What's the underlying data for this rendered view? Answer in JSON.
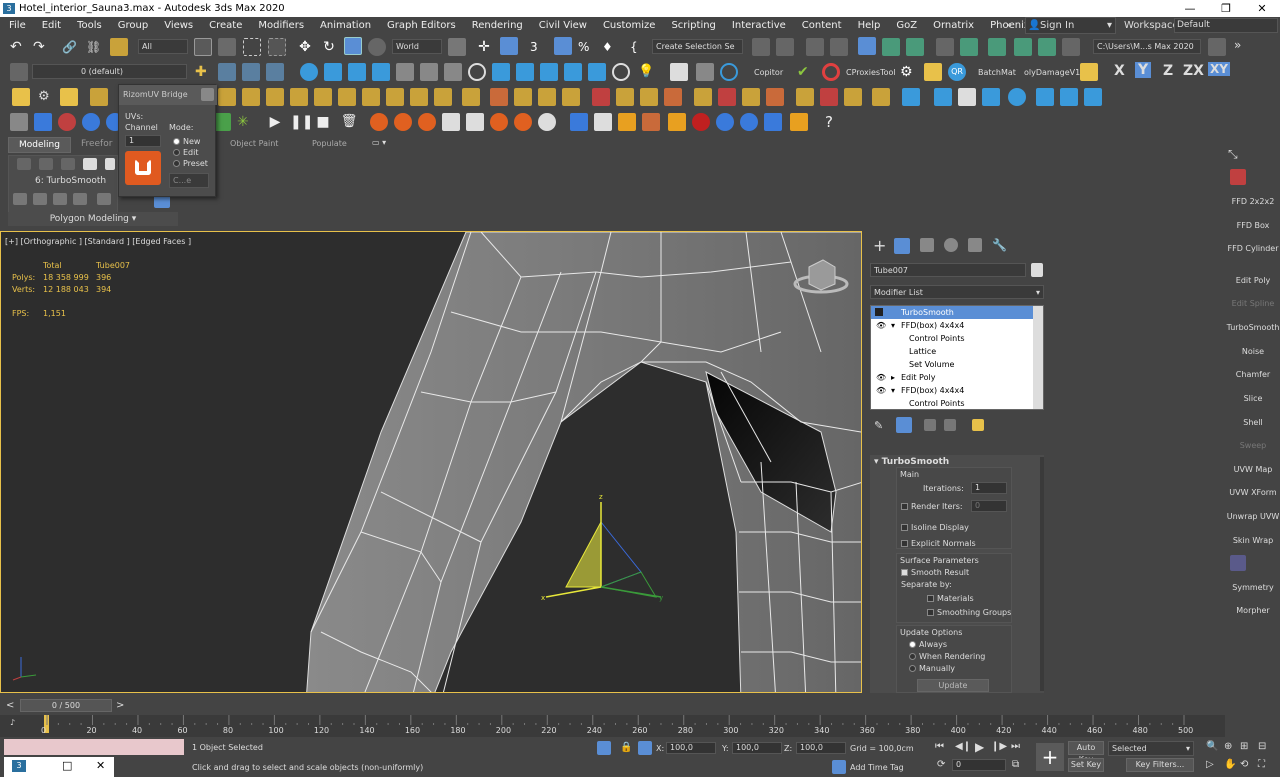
{
  "title": {
    "text": "Hotel_interior_Sauna3.max - Autodesk 3ds Max 2020"
  },
  "menu": [
    "File",
    "Edit",
    "Tools",
    "Group",
    "Views",
    "Create",
    "Modifiers",
    "Animation",
    "Graph Editors",
    "Rendering",
    "Civil View",
    "Customize",
    "Scripting",
    "Interactive",
    "Content",
    "Help",
    "GoZ",
    "Ornatrix",
    "Phoenix FD"
  ],
  "signin": {
    "label": "Sign In"
  },
  "workspace": {
    "label": "Workspaces:",
    "value": "Default"
  },
  "toolbar": {
    "filter": "All",
    "refcoord": "World",
    "selset": "Create Selection Se",
    "path": "C:\\Users\\M...s Max 2020",
    "layer": "0 (default)",
    "copitor": "Copitor",
    "cproxies": "CProxiesTool",
    "batchmat": "BatchMat",
    "polydamage": "olyDamageV1",
    "xyz": [
      "X",
      "Y",
      "Z",
      "ZX",
      "XY"
    ]
  },
  "rizom": {
    "title": "RizomUV Bridge",
    "uvs": "UVs:",
    "channel": "Channel",
    "channel_value": "1",
    "mode": "Mode:",
    "modes": [
      "New",
      "Edit",
      "Preset"
    ],
    "preset_value": "C...e"
  },
  "ribbon": {
    "tabs": [
      "Modeling",
      "Freefor",
      "Object Paint",
      "Populate"
    ],
    "turbo": "6: TurboSmooth",
    "polymodeling": "Polygon Modeling"
  },
  "viewport": {
    "label": "[+] [Orthographic ] [Standard ] [Edged Faces ]",
    "stats": {
      "hdr_total": "Total",
      "hdr_obj": "Tube007",
      "polys_label": "Polys:",
      "polys_total": "18 358 999",
      "polys_obj": "396",
      "verts_label": "Verts:",
      "verts_total": "12 188 043",
      "verts_obj": "394",
      "fps_label": "FPS:",
      "fps_value": "1,151"
    }
  },
  "command": {
    "object_name": "Tube007",
    "modifier_list": "Modifier List",
    "stack": [
      "TurboSmooth",
      "FFD(box) 4x4x4",
      "Control Points",
      "Lattice",
      "Set Volume",
      "Edit Poly",
      "FFD(box) 4x4x4",
      "Control Points"
    ],
    "rollout": "TurboSmooth",
    "main": "Main",
    "iterations_label": "Iterations:",
    "iterations_value": "1",
    "render_iters_label": "Render Iters:",
    "render_iters_value": "0",
    "isoline": "Isoline Display",
    "explicit": "Explicit Normals",
    "surface": "Surface Parameters",
    "smooth_result": "Smooth Result",
    "separate_by": "Separate by:",
    "materials": "Materials",
    "smoothing_groups": "Smoothing Groups",
    "update_options": "Update Options",
    "always": "Always",
    "when_rendering": "When Rendering",
    "manually": "Manually",
    "update": "Update"
  },
  "rightpanel": [
    "FFD 2x2x2",
    "FFD Box",
    "FFD Cylinder",
    "Edit Poly",
    "Edit Spline",
    "TurboSmooth",
    "Noise",
    "Chamfer",
    "Slice",
    "Shell",
    "Sweep",
    "UVW Map",
    "UVW XForm",
    "Unwrap UVW",
    "Skin Wrap",
    "Symmetry",
    "Morpher"
  ],
  "timeline": {
    "frame": "0 / 500",
    "ticks": [
      "0",
      "20",
      "40",
      "60",
      "80",
      "100",
      "120",
      "140",
      "160",
      "180",
      "200",
      "220",
      "240",
      "260",
      "280",
      "300",
      "320",
      "340",
      "360",
      "380",
      "400",
      "420",
      "440",
      "460",
      "480",
      "500"
    ]
  },
  "status": {
    "selected": "1 Object Selected",
    "prompt": "Click and drag to select and scale objects (non-uniformly)",
    "x_label": "X:",
    "x": "100,0",
    "y_label": "Y:",
    "y": "100,0",
    "z_label": "Z:",
    "z": "100,0",
    "grid": "Grid = 100,0cm",
    "addtime": "Add Time Tag",
    "autokey": "Auto Key",
    "setkey": "Set Key",
    "selected_drop": "Selected",
    "keyfilters": "Key Filters...",
    "frame_field": "0"
  }
}
